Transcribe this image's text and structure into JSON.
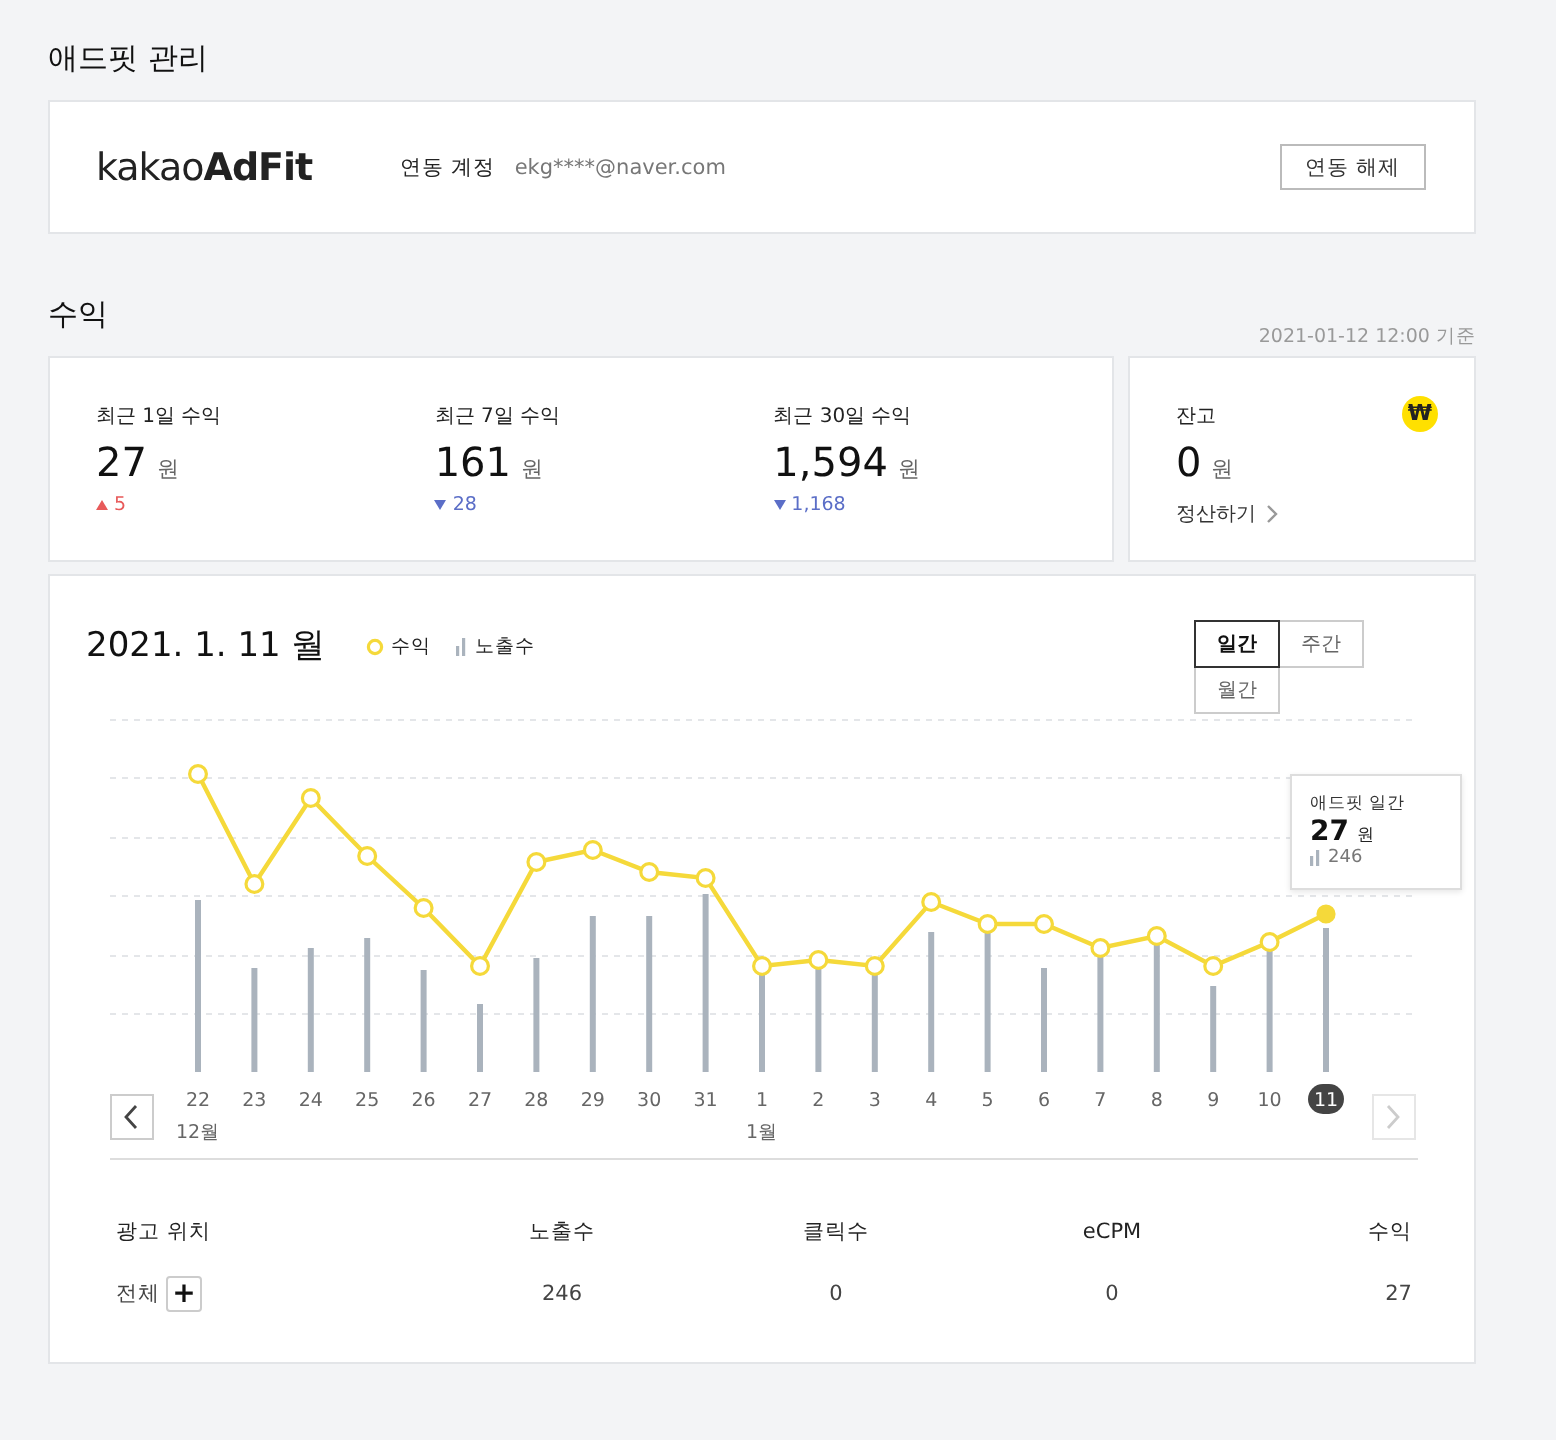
{
  "management": {
    "title": "애드핏 관리",
    "logo": "kakao**AdFit**",
    "account_label": "연동 계정",
    "account_email": "ekg****@naver.com",
    "unlink_button": "연동 해제"
  },
  "revenue": {
    "title": "수익",
    "timestamp": "2021-01-12 12:00 기준",
    "stats": [
      {
        "label": "최근 1일 수익",
        "value": "27",
        "unit": "원",
        "change": "5",
        "increase": true
      },
      {
        "label": "최근 7일 수익",
        "value": "161",
        "unit": "원",
        "change": "28",
        "increase": false
      },
      {
        "label": "최근 30일 수익",
        "value": "1,594",
        "unit": "원",
        "change": "1,168",
        "increase": false
      }
    ],
    "balance": {
      "label": "잔고",
      "currency_symbol": "₩",
      "value": "0",
      "unit": "원",
      "link": "정산하기"
    }
  },
  "chart": {
    "date": "2021. 1. 11 월",
    "legend": [
      {
        "label": "수익",
        "kind": "line"
      },
      {
        "label": "노출수",
        "kind": "bar"
      }
    ],
    "periods": [
      {
        "label": "일간",
        "selected": true
      },
      {
        "label": "주간",
        "selected": false
      },
      {
        "label": "월간",
        "selected": false
      }
    ],
    "dates": [
      {
        "day": "22",
        "month": "12월",
        "selected": false
      },
      {
        "day": "23",
        "selected": false
      },
      {
        "day": "24",
        "selected": false
      },
      {
        "day": "25",
        "selected": false
      },
      {
        "day": "26",
        "selected": false
      },
      {
        "day": "27",
        "selected": false
      },
      {
        "day": "28",
        "selected": false
      },
      {
        "day": "29",
        "selected": false
      },
      {
        "day": "30",
        "selected": false
      },
      {
        "day": "31",
        "selected": false
      },
      {
        "day": "1",
        "month": "1월",
        "selected": false
      },
      {
        "day": "2",
        "selected": false
      },
      {
        "day": "3",
        "selected": false
      },
      {
        "day": "4",
        "selected": false
      },
      {
        "day": "5",
        "selected": false
      },
      {
        "day": "6",
        "selected": false
      },
      {
        "day": "7",
        "selected": false
      },
      {
        "day": "8",
        "selected": false
      },
      {
        "day": "9",
        "selected": false
      },
      {
        "day": "10",
        "selected": false
      },
      {
        "day": "11",
        "selected": true
      }
    ],
    "prev_disabled": false,
    "next_disabled": true,
    "tooltip": {
      "title": "애드핏 일간",
      "value": "27",
      "unit": "원",
      "impressions": "246"
    }
  },
  "table": {
    "columns": [
      "광고 위치",
      "노출수",
      "클릭수",
      "eCPM",
      "수익"
    ],
    "expand_symbol": "+",
    "rows": [
      [
        "전체",
        "246",
        "0",
        "0",
        "27"
      ]
    ]
  }
}
